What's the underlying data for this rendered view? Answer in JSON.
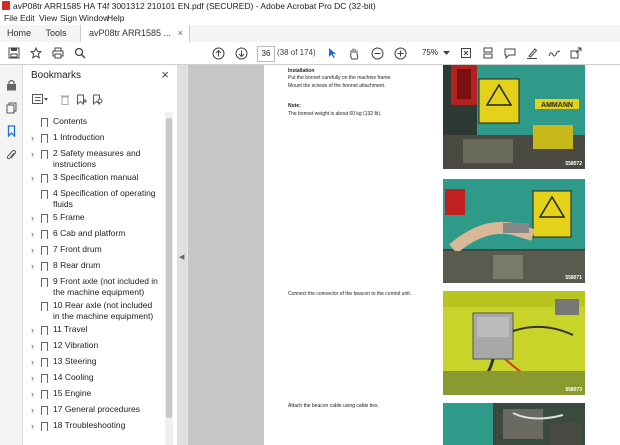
{
  "window": {
    "title": "avP08tr ARR1585 HA T4f 3001312 210101 EN.pdf (SECURED) - Adobe Acrobat Pro DC (32-bit)"
  },
  "menu": [
    "File",
    "Edit",
    "View",
    "Sign",
    "Window",
    "Help"
  ],
  "tabs": {
    "home": "Home",
    "tools": "Tools",
    "document": "avP08tr ARR1585 ...",
    "close": "×"
  },
  "toolbar": {
    "page_number": "36",
    "page_count": "(38 of 174)",
    "zoom": "75%"
  },
  "icons": {
    "toolbar": [
      "save-icon",
      "bookmark-star-icon",
      "print-icon",
      "search-icon",
      "previous-page-icon",
      "next-page-icon",
      "select-cursor-icon",
      "hand-icon",
      "zoom-out-icon",
      "zoom-in-icon",
      "zoom-dropdown-icon",
      "fit-page-icon",
      "scroll-mode-icon",
      "comment-icon",
      "highlight-icon",
      "sign-icon",
      "share-icon"
    ],
    "sidebar": [
      "lock-icon",
      "pages-icon",
      "bookmarks-icon",
      "attachments-icon"
    ]
  },
  "bookmarks": {
    "title": "Bookmarks",
    "close": "×",
    "items": [
      {
        "label": "Contents",
        "expandable": false
      },
      {
        "label": "1 Introduction",
        "expandable": true
      },
      {
        "label": "2 Safety measures and instructions",
        "expandable": true
      },
      {
        "label": "3 Specification manual",
        "expandable": true
      },
      {
        "label": "4 Specification of operating fluids",
        "expandable": false
      },
      {
        "label": "5 Frame",
        "expandable": true
      },
      {
        "label": "6 Cab and platform",
        "expandable": true
      },
      {
        "label": "7 Front drum",
        "expandable": true
      },
      {
        "label": "8 Rear drum",
        "expandable": true
      },
      {
        "label": "9 Front axle (not included in the machine equipment)",
        "expandable": false
      },
      {
        "label": "10 Rear axle (not included in the machine equipment)",
        "expandable": false
      },
      {
        "label": "11 Travel",
        "expandable": true
      },
      {
        "label": "12 Vibration",
        "expandable": true
      },
      {
        "label": "13 Steering",
        "expandable": true
      },
      {
        "label": "14 Cooling",
        "expandable": true
      },
      {
        "label": "15 Engine",
        "expandable": true
      },
      {
        "label": "17 General procedures",
        "expandable": true
      },
      {
        "label": "18 Troubleshooting",
        "expandable": true
      }
    ]
  },
  "document": {
    "installation_heading": "Installation",
    "installation_line1": "Put the bonnet carefully on the machine frame.",
    "installation_line2": "Mount the screws of the bonnet attachment.",
    "note_heading": "Note:",
    "note_text": "The bonnet weight is about 60 kg (132 lb).",
    "connector_text": "Connect the connector of the beacon to the control unit.",
    "cable_text": "Attach the beacon cable using cable ties.",
    "photo_codes": [
      "558072",
      "558071",
      "558073"
    ],
    "logo_text": "AMMANN"
  }
}
